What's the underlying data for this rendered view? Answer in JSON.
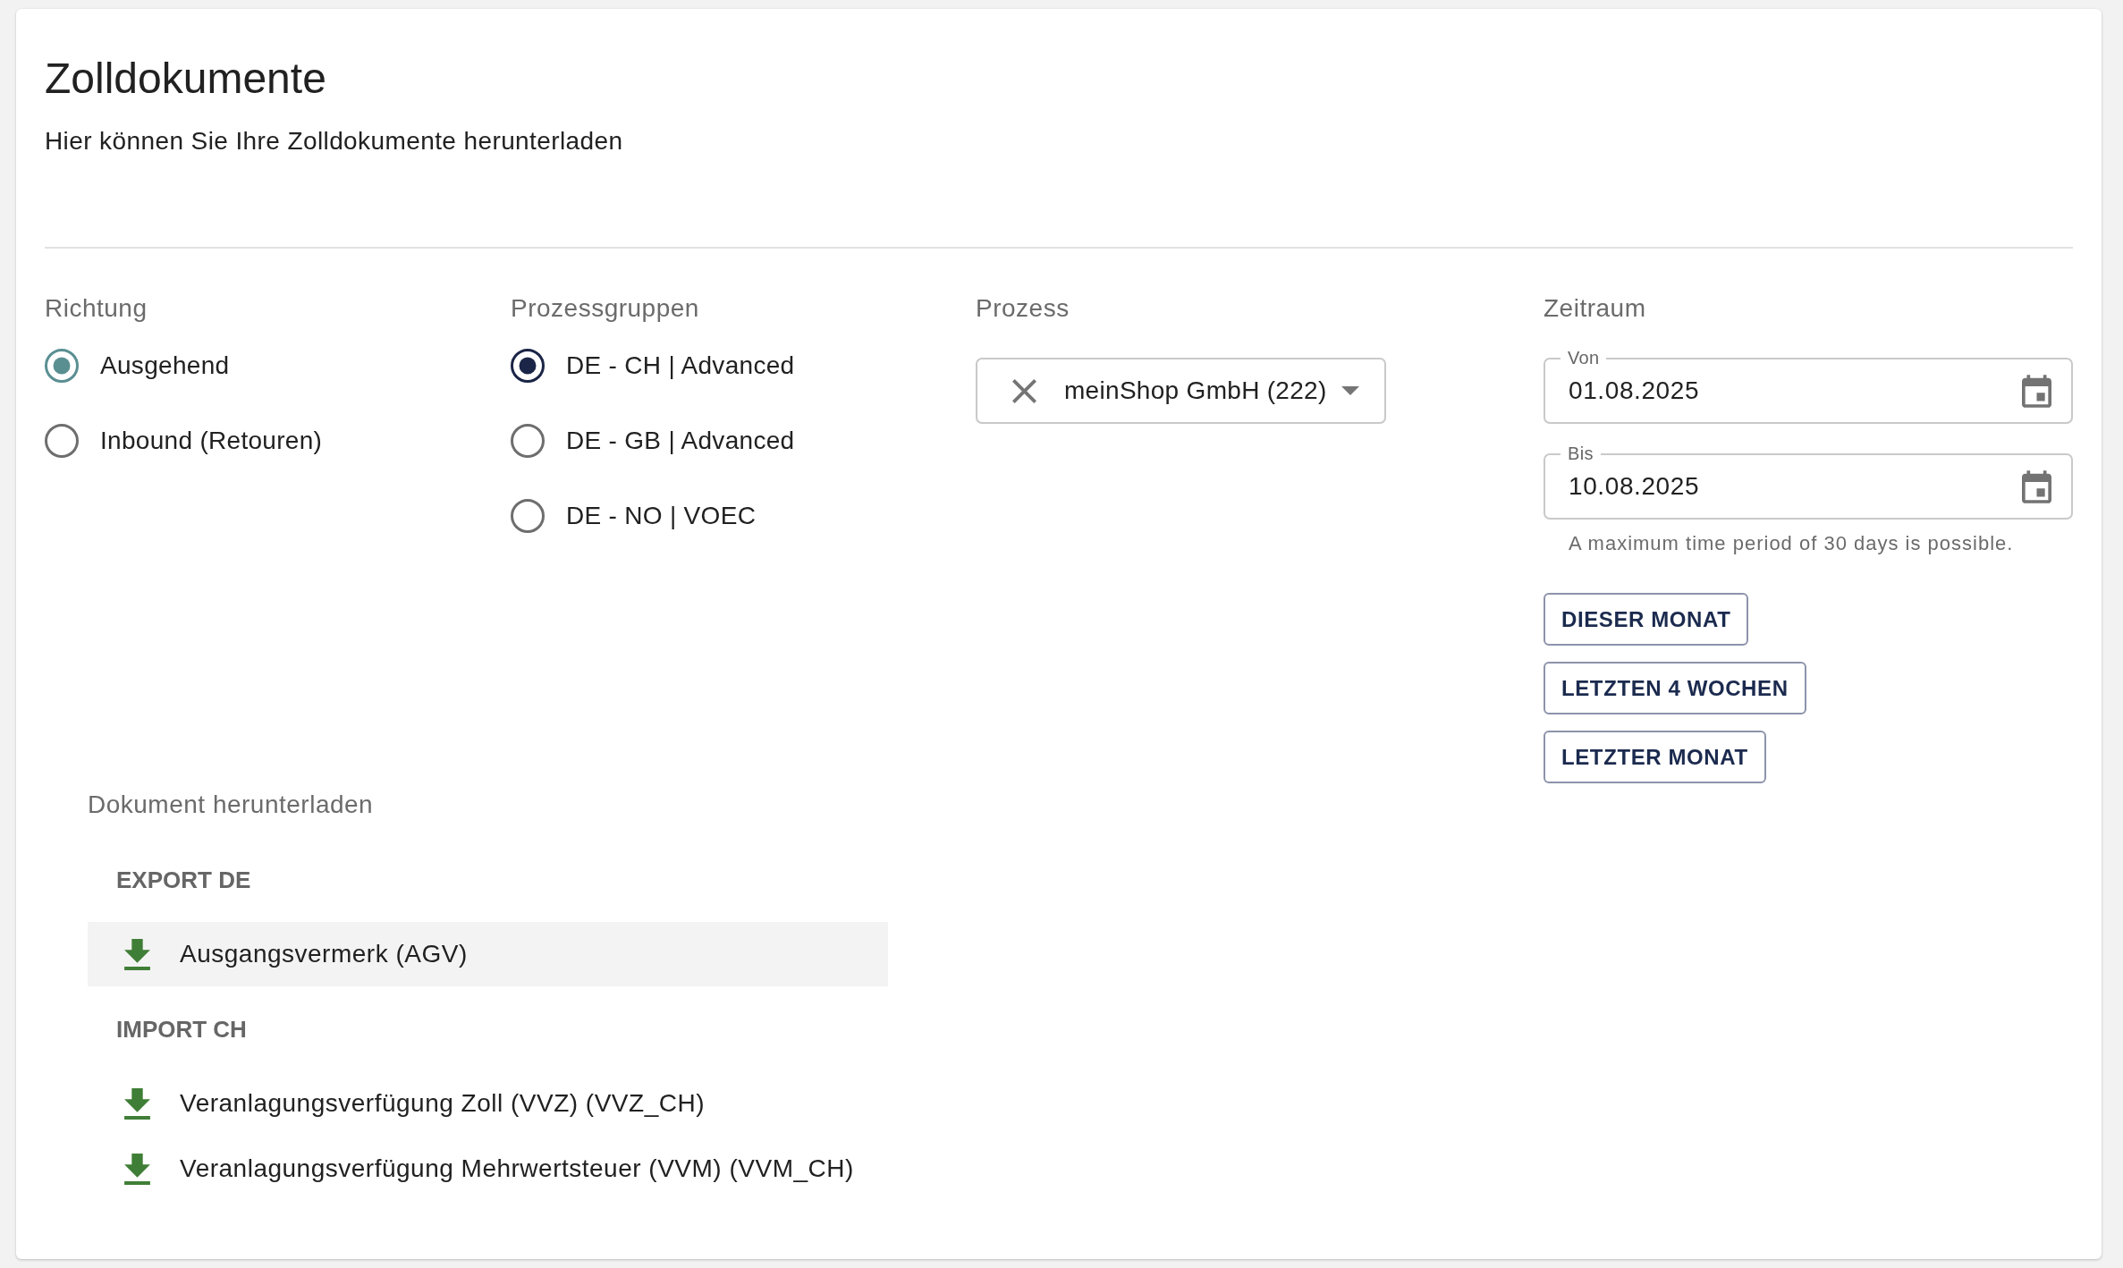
{
  "page": {
    "title": "Zolldokumente",
    "subtitle": "Hier können Sie Ihre Zolldokumente herunterladen"
  },
  "filters": [
    {
      "kind": "radio",
      "label": "Richtung",
      "color": "#5a8f92",
      "options": [
        {
          "label": "Ausgehend",
          "selected": true
        },
        {
          "label": "Inbound (Retouren)",
          "selected": false
        }
      ]
    },
    {
      "kind": "radio",
      "label": "Prozessgruppen",
      "color": "#1b2547",
      "options": [
        {
          "label": "DE - CH | Advanced",
          "selected": true
        },
        {
          "label": "DE - GB | Advanced",
          "selected": false
        },
        {
          "label": "DE - NO | VOEC",
          "selected": false
        }
      ]
    },
    {
      "kind": "select",
      "label": "Prozess",
      "value": "meinShop GmbH (222)"
    },
    {
      "kind": "date_range",
      "label": "Zeitraum",
      "fields": [
        {
          "label": "Von",
          "value": "01.08.2025"
        },
        {
          "label": "Bis",
          "value": "10.08.2025"
        }
      ],
      "helper": "A maximum time period of 30 days is possible.",
      "presets": [
        "DIESER MONAT",
        "LETZTEN 4 WOCHEN",
        "LETZTER MONAT"
      ]
    }
  ],
  "downloads": {
    "title": "Dokument herunterladen",
    "groups": [
      {
        "title": "EXPORT DE",
        "items": [
          {
            "label": "Ausgangsvermerk (AGV)",
            "hovered": true
          }
        ]
      },
      {
        "title": "IMPORT CH",
        "items": [
          {
            "label": "Veranlagungsverfügung Zoll (VVZ) (VVZ_CH)",
            "hovered": false
          },
          {
            "label": "Veranlagungsverfügung Mehrwertsteuer (VVM) (VVM_CH)",
            "hovered": false
          }
        ]
      }
    ]
  }
}
